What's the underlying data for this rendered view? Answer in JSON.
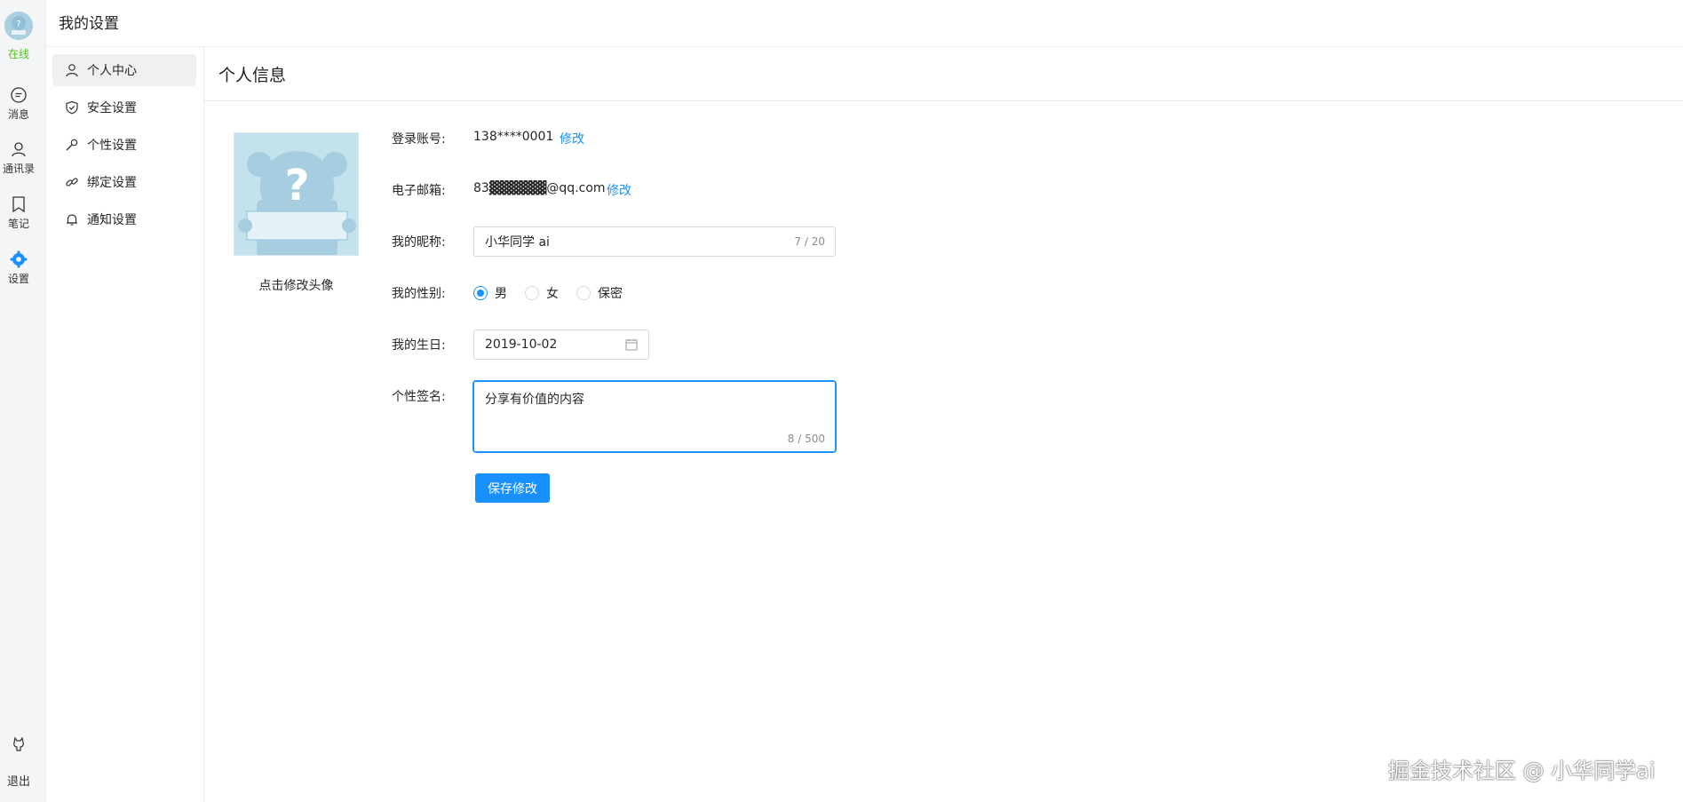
{
  "rail": {
    "status": "在线",
    "items": [
      {
        "label": "消息",
        "icon": "chat-icon"
      },
      {
        "label": "通讯录",
        "icon": "contacts-icon"
      },
      {
        "label": "笔记",
        "icon": "notes-icon"
      },
      {
        "label": "设置",
        "icon": "gear-icon"
      }
    ],
    "logout": "退出",
    "accent": "#1890ff",
    "status_color": "#52c41a"
  },
  "header": {
    "title": "我的设置"
  },
  "menu": {
    "items": [
      {
        "label": "个人中心",
        "icon": "user-icon",
        "active": true
      },
      {
        "label": "安全设置",
        "icon": "shield-icon"
      },
      {
        "label": "个性设置",
        "icon": "wrench-icon"
      },
      {
        "label": "绑定设置",
        "icon": "link-icon"
      },
      {
        "label": "通知设置",
        "icon": "bell-icon"
      }
    ]
  },
  "page": {
    "title": "个人信息"
  },
  "avatar": {
    "caption": "点击修改头像"
  },
  "form": {
    "account": {
      "label": "登录账号:",
      "value": "138****0001",
      "action": "修改"
    },
    "email": {
      "label": "电子邮箱:",
      "value": "83▓▓▓▓▓▓@qq.com",
      "action": "修改"
    },
    "nickname": {
      "label": "我的昵称:",
      "value": "小华同学 ai",
      "count": "7 / 20"
    },
    "gender": {
      "label": "我的性别:",
      "options": [
        "男",
        "女",
        "保密"
      ],
      "selected": "男"
    },
    "birthday": {
      "label": "我的生日:",
      "value": "2019-10-02"
    },
    "signature": {
      "label": "个性签名:",
      "value": "分享有价值的内容",
      "count": "8 / 500"
    },
    "submit": "保存修改"
  },
  "watermark": "掘金技术社区 @ 小华同学ai"
}
